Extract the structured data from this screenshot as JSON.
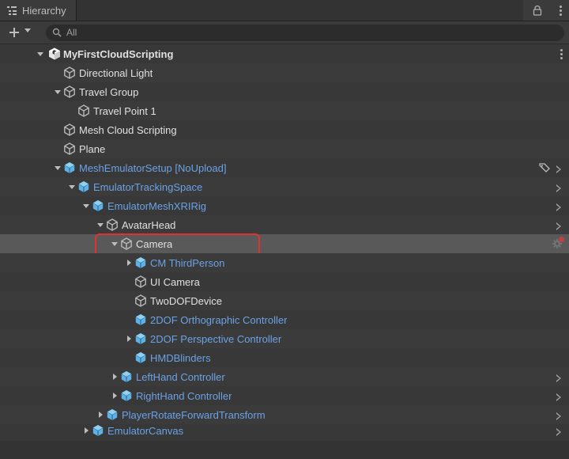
{
  "tab": {
    "title": "Hierarchy"
  },
  "toolbar": {
    "search_placeholder": "All"
  },
  "colors": {
    "prefab": "#6aa2e6",
    "normal": "#c6c6c6",
    "accent": "#e03232"
  },
  "tree": {
    "root": {
      "label": "MyFirstCloudScripting",
      "bold": true,
      "icon": "unity",
      "expanded": true
    },
    "items": [
      {
        "label": "Directional Light",
        "depth": 1,
        "prefab": false,
        "fold": "none",
        "extras": []
      },
      {
        "label": "Travel Group",
        "depth": 1,
        "prefab": false,
        "fold": "expanded",
        "extras": []
      },
      {
        "label": "Travel Point 1",
        "depth": 2,
        "prefab": false,
        "fold": "none",
        "extras": []
      },
      {
        "label": "Mesh Cloud Scripting",
        "depth": 1,
        "prefab": false,
        "fold": "none",
        "extras": []
      },
      {
        "label": "Plane",
        "depth": 1,
        "prefab": false,
        "fold": "none",
        "extras": []
      },
      {
        "label": "MeshEmulatorSetup [NoUpload]",
        "depth": 1,
        "prefab": true,
        "fold": "expanded",
        "extras": [
          "tag",
          "chev"
        ]
      },
      {
        "label": "EmulatorTrackingSpace",
        "depth": 2,
        "prefab": true,
        "fold": "expanded",
        "extras": [
          "chev"
        ]
      },
      {
        "label": "EmulatorMeshXRIRig",
        "depth": 3,
        "prefab": true,
        "fold": "expanded",
        "extras": [
          "chev"
        ]
      },
      {
        "label": "AvatarHead",
        "depth": 4,
        "prefab": false,
        "fold": "expanded",
        "extras": [
          "chev"
        ]
      },
      {
        "label": "Camera",
        "depth": 5,
        "prefab": false,
        "fold": "expanded",
        "extras": [
          "gear"
        ],
        "selected": true,
        "highlight": true
      },
      {
        "label": "CM ThirdPerson",
        "depth": 6,
        "prefab": true,
        "fold": "collapsed",
        "extras": []
      },
      {
        "label": "UI Camera",
        "depth": 6,
        "prefab": false,
        "fold": "none",
        "extras": []
      },
      {
        "label": "TwoDOFDevice",
        "depth": 6,
        "prefab": false,
        "fold": "none",
        "extras": []
      },
      {
        "label": "2DOF Orthographic Controller",
        "depth": 6,
        "prefab": true,
        "fold": "none",
        "extras": []
      },
      {
        "label": "2DOF Perspective Controller",
        "depth": 6,
        "prefab": true,
        "fold": "collapsed",
        "extras": []
      },
      {
        "label": "HMDBlinders",
        "depth": 6,
        "prefab": true,
        "fold": "none",
        "extras": []
      },
      {
        "label": "LeftHand Controller",
        "depth": 5,
        "prefab": true,
        "fold": "collapsed",
        "extras": [
          "chev"
        ]
      },
      {
        "label": "RightHand Controller",
        "depth": 5,
        "prefab": true,
        "fold": "collapsed",
        "extras": [
          "chev"
        ]
      },
      {
        "label": "PlayerRotateForwardTransform",
        "depth": 4,
        "prefab": true,
        "fold": "collapsed",
        "extras": [
          "chev"
        ]
      },
      {
        "label": "EmulatorCanvas",
        "depth": 3,
        "prefab": true,
        "fold": "collapsed",
        "extras": [
          "chev"
        ],
        "cutoff": true
      }
    ]
  }
}
